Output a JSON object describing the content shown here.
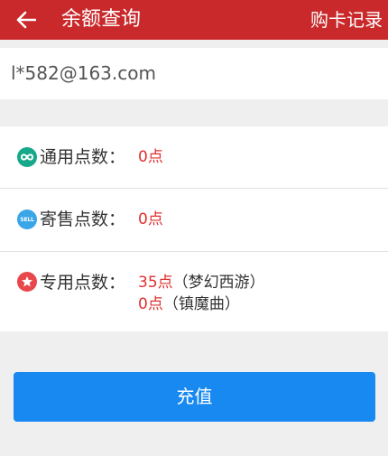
{
  "header": {
    "back_icon": "arrow-left-icon",
    "title": "余额查询",
    "records_label": "购卡记录",
    "bg_color": "#c9292b"
  },
  "account": {
    "email": "l*582@163.com"
  },
  "points": {
    "general": {
      "icon": "infinity-icon",
      "label": "通用点数：",
      "value": "0点"
    },
    "consign": {
      "icon": "sell-icon",
      "icon_text": "SELL",
      "label": "寄售点数：",
      "value": "0点"
    },
    "dedicated": {
      "icon": "star-badge-icon",
      "label": "专用点数：",
      "entries": [
        {
          "value": "35点",
          "game": "（梦幻西游）"
        },
        {
          "value": "0点",
          "game": "（镇魔曲）"
        }
      ]
    }
  },
  "recharge_button": {
    "label": "充值",
    "color": "#1889f0"
  }
}
